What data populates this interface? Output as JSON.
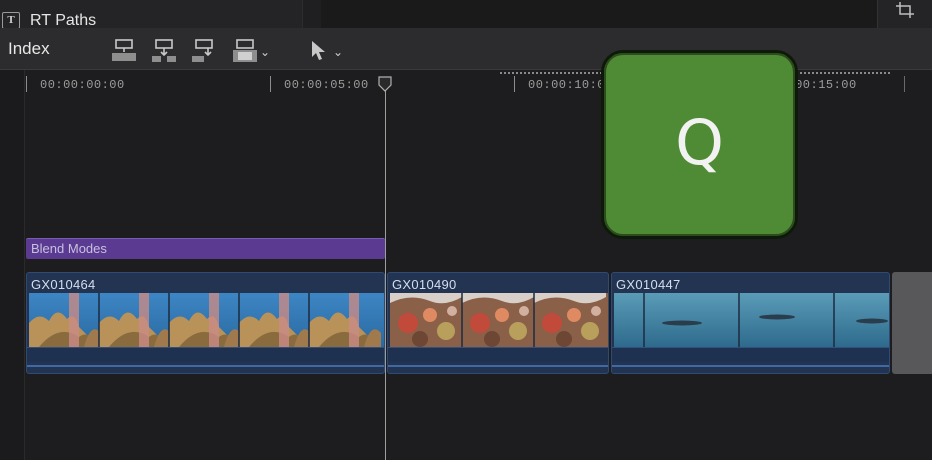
{
  "browser": {
    "item_label": "RT Paths",
    "item_icon": "title-icon"
  },
  "toolbar": {
    "index_label": "Index",
    "tools": [
      {
        "name": "connect-clip-icon"
      },
      {
        "name": "insert-clip-icon"
      },
      {
        "name": "append-clip-icon"
      },
      {
        "name": "overwrite-clip-icon",
        "has_menu": true
      },
      {
        "name": "select-tool-icon",
        "has_menu": true
      }
    ],
    "chevron": "⌄"
  },
  "ruler": {
    "timecodes": [
      "00:00:00:00",
      "00:00:05:00",
      "00:00:10:00",
      "00:00:15:00"
    ]
  },
  "timeline": {
    "title_clip": "Blend Modes",
    "clips": [
      {
        "name": "GX010464",
        "type": "reef"
      },
      {
        "name": "GX010490",
        "type": "coral"
      },
      {
        "name": "GX010447",
        "type": "fish"
      }
    ]
  },
  "overlay": {
    "key": "Q"
  },
  "colors": {
    "title_clip": "#5a3b91",
    "video_clip": "#223452",
    "overlay_key": "#4f8a35"
  }
}
